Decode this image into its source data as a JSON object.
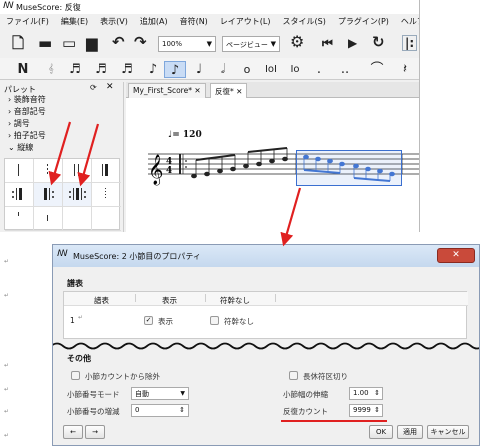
{
  "app": {
    "title": "MuseScore: 反復"
  },
  "menu": [
    "ファイル(F)",
    "編集(E)",
    "表示(V)",
    "追加(A)",
    "音符(N)",
    "レイアウト(L)",
    "スタイル(S)",
    "プラグイン(P)",
    "ヘルプ"
  ],
  "toolbar": {
    "zoom": "100%",
    "view_mode": "ページビュー"
  },
  "palette": {
    "title": "パレット",
    "items": [
      "装飾音符",
      "音部記号",
      "調号",
      "拍子記号",
      "縦線"
    ]
  },
  "tabs": [
    {
      "label": "My_First_Score*"
    },
    {
      "label": "反復*"
    }
  ],
  "score": {
    "tempo": "♩= 120"
  },
  "dialog": {
    "title": "MuseScore: 2 小節目のプロパティ",
    "staves_group": "譜表",
    "table_headers": [
      "譜表",
      "表示",
      "符幹なし"
    ],
    "row": {
      "num": "1",
      "visible": "表示",
      "stemless": "符幹なし"
    },
    "other_group": "その他",
    "exclude_count": "小節カウントから除外",
    "break_rest": "長休符区切り",
    "number_mode_label": "小節番号モード",
    "number_mode_value": "自動",
    "add_label": "小節番号の増減",
    "add_value": "0",
    "stretch_label": "小節幅の伸縮",
    "stretch_value": "1.00",
    "repeat_label": "反復カウント",
    "repeat_value": "9999",
    "ok": "OK",
    "apply": "適用",
    "cancel": "キャンセル"
  },
  "colors": {
    "arrow": "#e02020",
    "selection": "#3a6fd0",
    "underline": "#e02020"
  }
}
